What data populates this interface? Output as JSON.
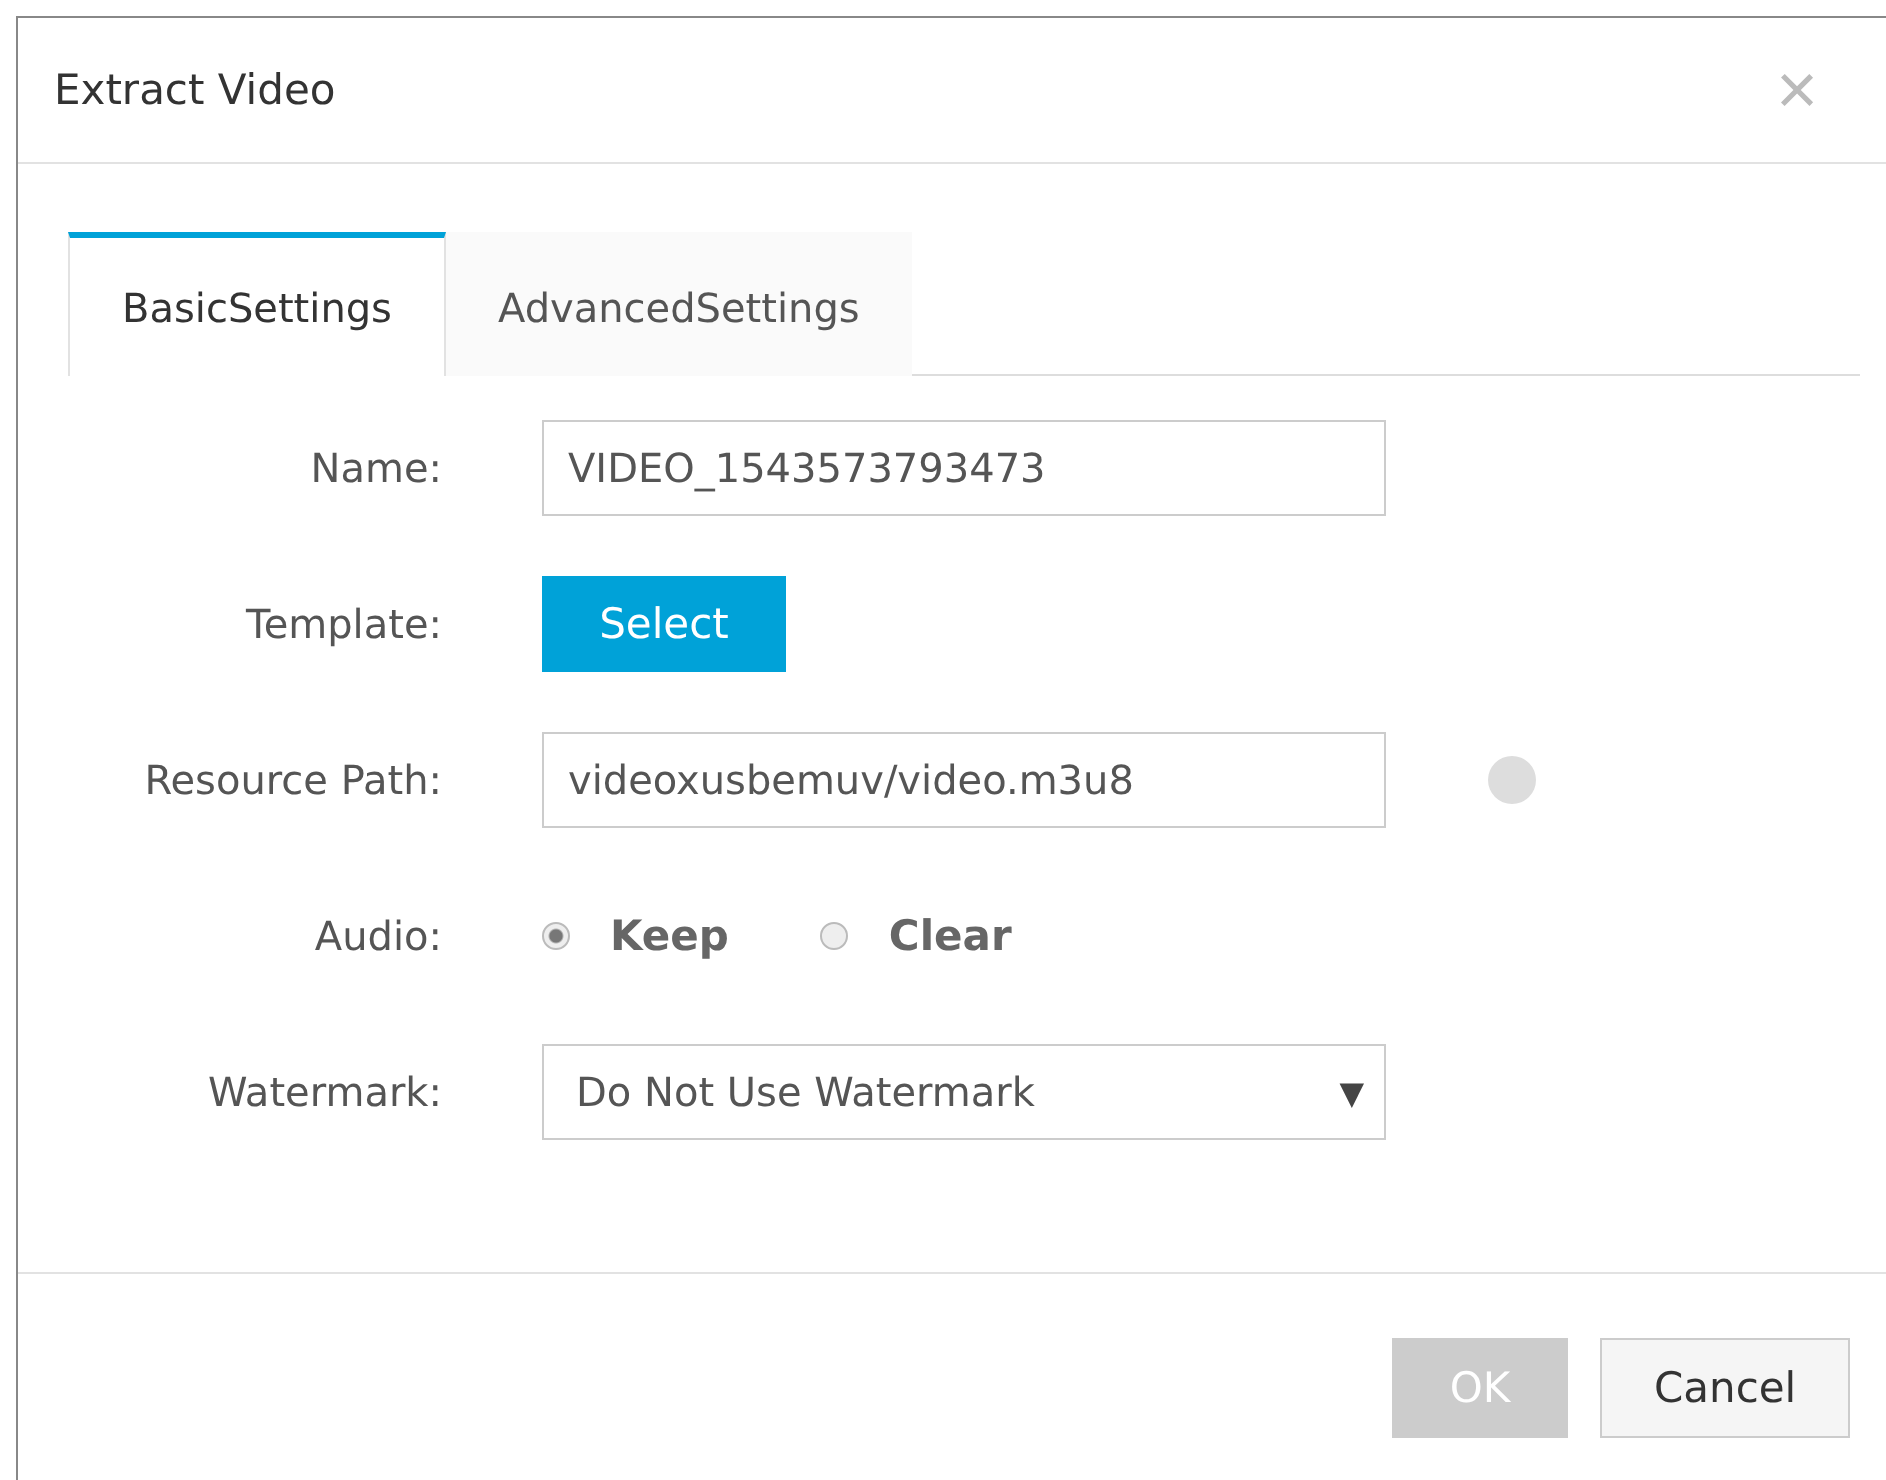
{
  "dialog": {
    "title": "Extract Video",
    "close": "×"
  },
  "tabs": [
    {
      "label": "BasicSettings",
      "selected": true
    },
    {
      "label": "AdvancedSettings",
      "selected": false
    }
  ],
  "form": [
    {
      "kind": "text",
      "label": "Name:",
      "value": "VIDEO_1543573793473"
    },
    {
      "kind": "button",
      "label": "Template:",
      "button": "Select"
    },
    {
      "kind": "text",
      "label": "Resource Path:",
      "value": "videoxusbemuv/video.m3u8",
      "info": true
    },
    {
      "kind": "radio",
      "label": "Audio:",
      "options": [
        {
          "label": "Keep",
          "selected": true
        },
        {
          "label": "Clear",
          "selected": false
        }
      ]
    },
    {
      "kind": "select",
      "label": "Watermark:",
      "value": "Do Not Use Watermark",
      "arrow": "▼"
    }
  ],
  "buttons": [
    {
      "label": "OK",
      "disabled": true
    },
    {
      "label": "Cancel",
      "disabled": false
    }
  ]
}
